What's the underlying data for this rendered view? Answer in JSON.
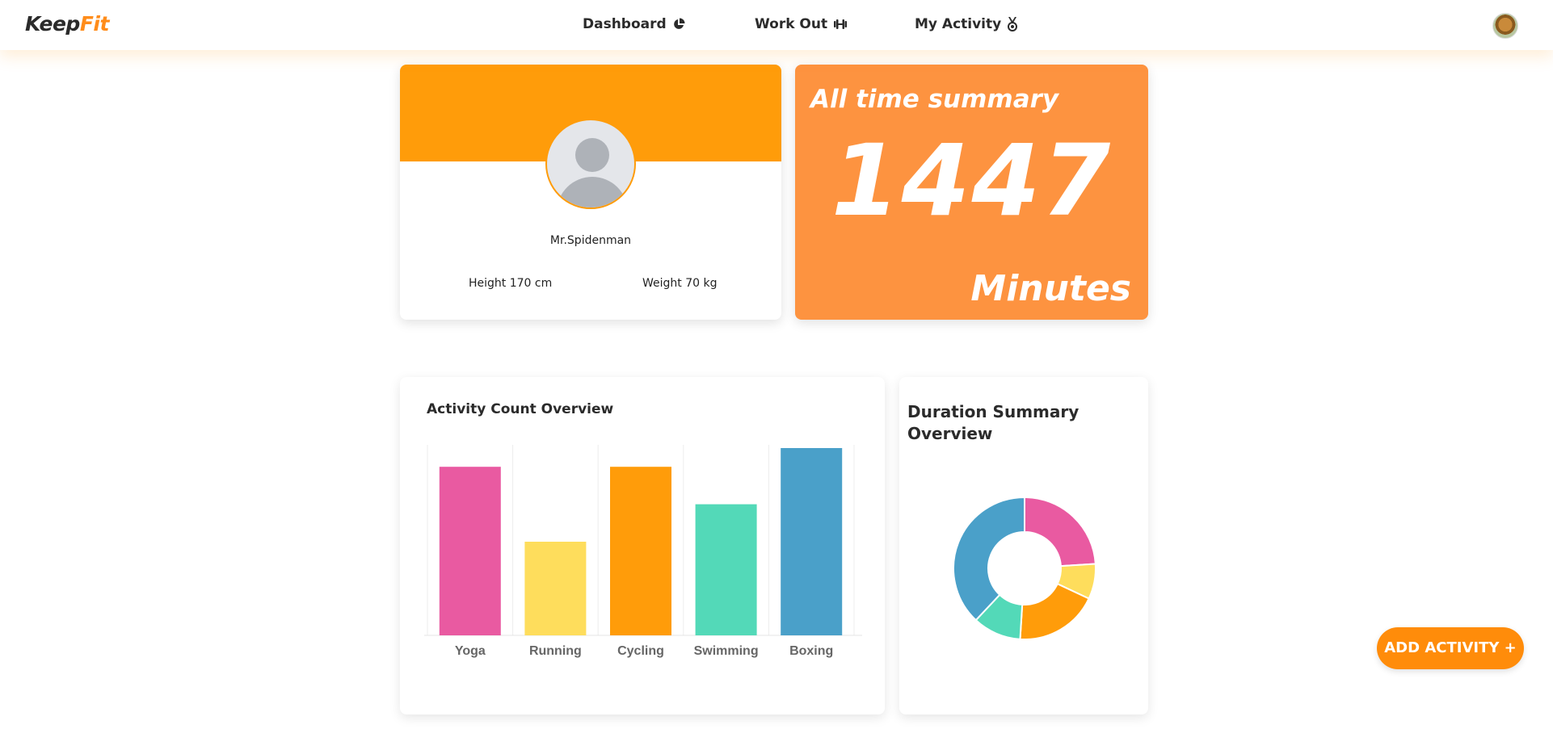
{
  "brand": {
    "part1": "Keep",
    "part2": "Fit"
  },
  "nav": {
    "dashboard": "Dashboard",
    "workout": "Work Out",
    "activity": "My Activity"
  },
  "profile": {
    "name": "Mr.Spidenman",
    "height": "Height 170 cm",
    "weight": "Weight 70 kg"
  },
  "summary": {
    "title": "All time summary",
    "value": "1447",
    "unit": "Minutes"
  },
  "bar_card": {
    "title": "Activity Count Overview"
  },
  "donut_card": {
    "title": "Duration Summary Overview"
  },
  "add_button": "ADD ACTIVITY +",
  "colors": {
    "accent": "#ff9c0a",
    "summary_bg": "#fd9340",
    "yoga": "#e95aa1",
    "running": "#fedd5c",
    "cycling": "#ff9c0a",
    "swimming": "#53d9b8",
    "boxing": "#4aa0c9"
  },
  "chart_data": [
    {
      "type": "bar",
      "title": "Activity Count Overview",
      "categories": [
        "Yoga",
        "Running",
        "Cycling",
        "Swimming",
        "Boxing"
      ],
      "values": [
        9,
        5,
        9,
        7,
        10
      ],
      "colors": [
        "#e95aa1",
        "#fedd5c",
        "#ff9c0a",
        "#53d9b8",
        "#4aa0c9"
      ],
      "ylim": [
        0,
        10
      ],
      "grid": true
    },
    {
      "type": "pie",
      "title": "Duration Summary Overview",
      "donut": true,
      "categories": [
        "Yoga",
        "Running",
        "Cycling",
        "Swimming",
        "Boxing"
      ],
      "values": [
        24,
        8,
        19,
        11,
        38
      ],
      "colors": [
        "#e95aa1",
        "#fedd5c",
        "#ff9c0a",
        "#53d9b8",
        "#4aa0c9"
      ]
    }
  ]
}
